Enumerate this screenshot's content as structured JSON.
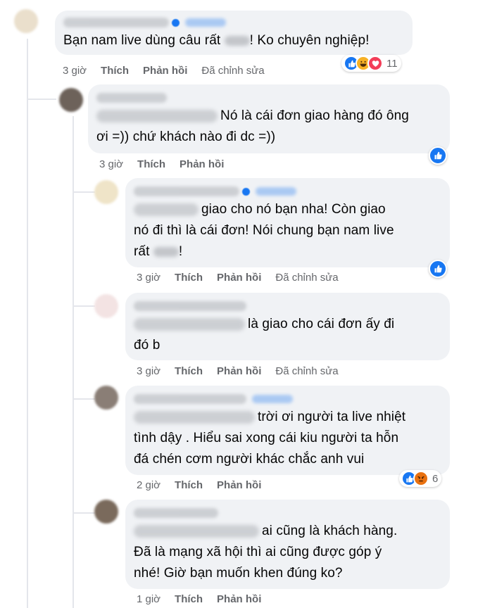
{
  "comments": [
    {
      "text": "Bạn nam live dùng câu rất",
      "text_after": "! Ko chuyên nghiệp!",
      "time": "3 giờ",
      "like": "Thích",
      "reply": "Phản hồi",
      "edited": "Đã chỉnh sửa",
      "reactions": [
        "like-icon",
        "haha-icon",
        "love-icon"
      ],
      "reaction_count": "11"
    },
    {
      "line1": "Nó là cái đơn giao hàng đó ông",
      "line2": "ơi =)) chứ khách nào đi dc =))",
      "time": "3 giờ",
      "like": "Thích",
      "reply": "Phản hồi",
      "reactions": [
        "like-icon"
      ]
    },
    {
      "line1": "giao cho nó bạn nha! Còn giao",
      "line2": "nó đi thì là cái đơn! Nói chung bạn nam live",
      "line3a": "rất",
      "line3b": "!",
      "time": "3 giờ",
      "like": "Thích",
      "reply": "Phản hồi",
      "edited": "Đã chỉnh sửa",
      "reactions": [
        "like-icon"
      ]
    },
    {
      "line1": "là giao cho cái đơn ấy đi",
      "line2": "đó b",
      "time": "3 giờ",
      "like": "Thích",
      "reply": "Phản hồi",
      "edited": "Đã chỉnh sửa"
    },
    {
      "line1": "trời ơi người ta live nhiệt",
      "line2": "tình dậy . Hiểu sai xong cái kiu người ta hỗn",
      "line3": "đá chén cơm người khác chắc anh vui",
      "time": "2 giờ",
      "like": "Thích",
      "reply": "Phản hồi",
      "reactions": [
        "like-icon",
        "angry-icon"
      ],
      "reaction_count": "6"
    },
    {
      "line1": "ai cũng là khách hàng.",
      "line2": "Đã là mạng xã hội thì ai cũng được góp ý",
      "line3": "nhé! Giờ bạn muốn khen đúng ko?",
      "time": "1 giờ",
      "like": "Thích",
      "reply": "Phản hồi"
    }
  ],
  "colors": {
    "bubble": "#f0f2f5",
    "meta_text": "#65676b",
    "like_blue": "#1877f2",
    "haha_yellow": "#f7b125",
    "love_red": "#f33e58",
    "angry_orange": "#e9710f"
  }
}
